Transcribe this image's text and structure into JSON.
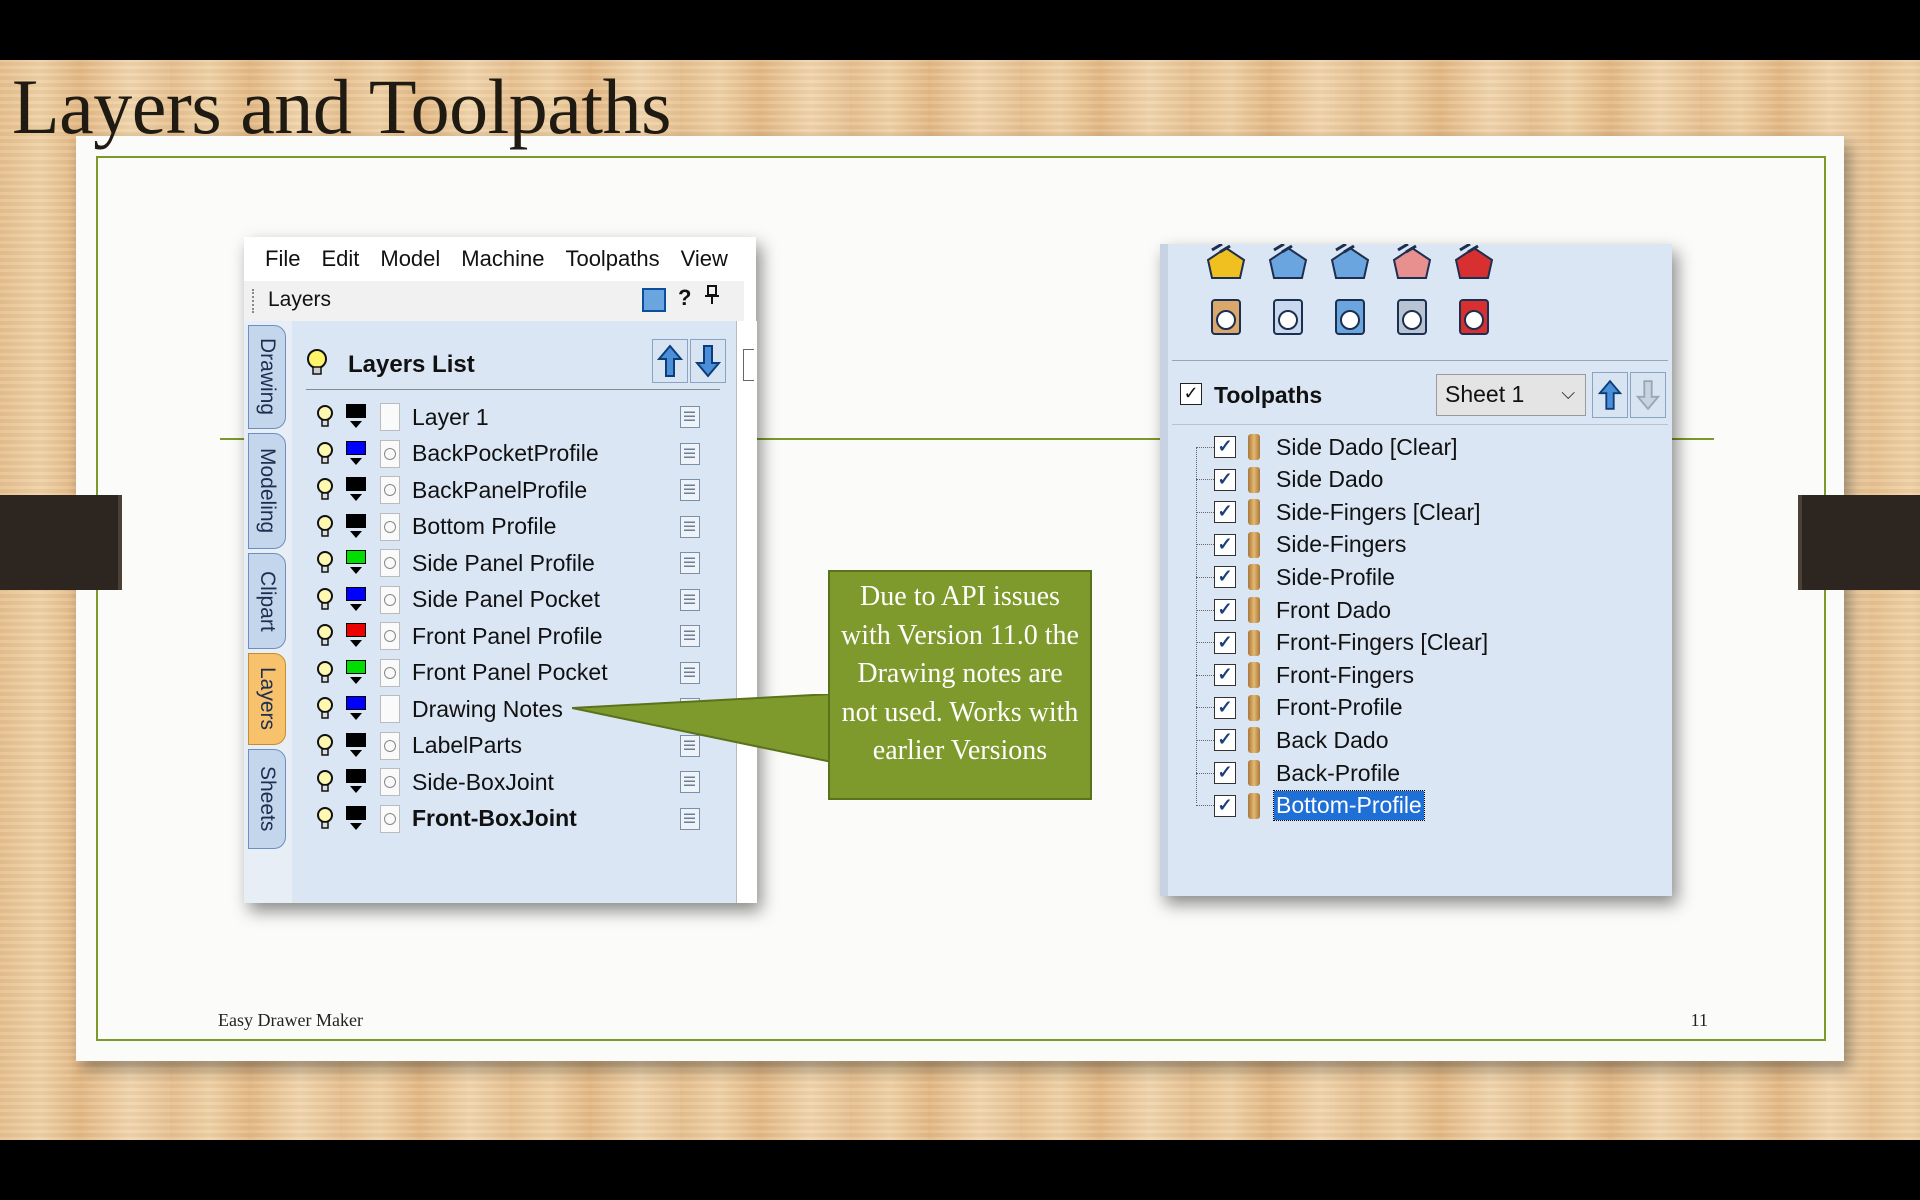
{
  "slide": {
    "title": "Layers and Toolpaths",
    "footer_left": "Easy Drawer Maker",
    "page_number": "11"
  },
  "layers_window": {
    "menu": [
      "File",
      "Edit",
      "Model",
      "Machine",
      "Toolpaths",
      "View"
    ],
    "panel_title": "Layers",
    "help_label": "?",
    "side_tabs": [
      "Drawing",
      "Modeling",
      "Clipart",
      "Layers",
      "Sheets"
    ],
    "active_tab": "Layers",
    "list_title": "Layers List",
    "layers": [
      {
        "name": "Layer 1",
        "color": "#000000",
        "bold": false,
        "linked": false
      },
      {
        "name": "BackPocketProfile",
        "color": "#0000ff",
        "bold": false,
        "linked": true
      },
      {
        "name": "BackPanelProfile",
        "color": "#000000",
        "bold": false,
        "linked": true
      },
      {
        "name": "Bottom Profile",
        "color": "#000000",
        "bold": false,
        "linked": true
      },
      {
        "name": "Side Panel Profile",
        "color": "#00dd00",
        "bold": false,
        "linked": true
      },
      {
        "name": "Side Panel Pocket",
        "color": "#0000ff",
        "bold": false,
        "linked": true
      },
      {
        "name": "Front Panel Profile",
        "color": "#ee0000",
        "bold": false,
        "linked": true
      },
      {
        "name": "Front Panel Pocket",
        "color": "#00dd00",
        "bold": false,
        "linked": true
      },
      {
        "name": "Drawing Notes",
        "color": "#0000ff",
        "bold": false,
        "linked": false
      },
      {
        "name": "LabelParts",
        "color": "#000000",
        "bold": false,
        "linked": true
      },
      {
        "name": "Side-BoxJoint",
        "color": "#000000",
        "bold": false,
        "linked": true
      },
      {
        "name": "Front-BoxJoint",
        "color": "#000000",
        "bold": true,
        "linked": true
      }
    ]
  },
  "callout": {
    "text": "Due to API issues with Version 11.0 the Drawing notes are not used. Works with earlier Versions"
  },
  "toolpaths_window": {
    "toolbar_icons": [
      "open-folder-icon",
      "toolpath-house-icon",
      "toolpath-house-2-icon",
      "toolpath-grid-icon",
      "toolpath-star-icon",
      "hand-pointer-icon",
      "gcode-clock-icon",
      "sliders-icon",
      "settings-sheet-icon",
      "gcode-save-icon"
    ],
    "title": "Toolpaths",
    "sheet_selector": "Sheet 1",
    "toolpaths": [
      {
        "name": "Side Dado [Clear]",
        "checked": true,
        "selected": false
      },
      {
        "name": "Side Dado",
        "checked": true,
        "selected": false
      },
      {
        "name": "Side-Fingers [Clear]",
        "checked": true,
        "selected": false
      },
      {
        "name": "Side-Fingers",
        "checked": true,
        "selected": false
      },
      {
        "name": "Side-Profile",
        "checked": true,
        "selected": false
      },
      {
        "name": "Front Dado",
        "checked": true,
        "selected": false
      },
      {
        "name": "Front-Fingers [Clear]",
        "checked": true,
        "selected": false
      },
      {
        "name": "Front-Fingers",
        "checked": true,
        "selected": false
      },
      {
        "name": "Front-Profile",
        "checked": true,
        "selected": false
      },
      {
        "name": "Back Dado",
        "checked": true,
        "selected": false
      },
      {
        "name": "Back-Profile",
        "checked": true,
        "selected": false
      },
      {
        "name": "Bottom-Profile",
        "checked": true,
        "selected": true
      }
    ]
  },
  "colors": {
    "accent_green": "#7e9a2c",
    "panel_blue": "#dbe6f4",
    "selection_blue": "#1e6fd6"
  }
}
